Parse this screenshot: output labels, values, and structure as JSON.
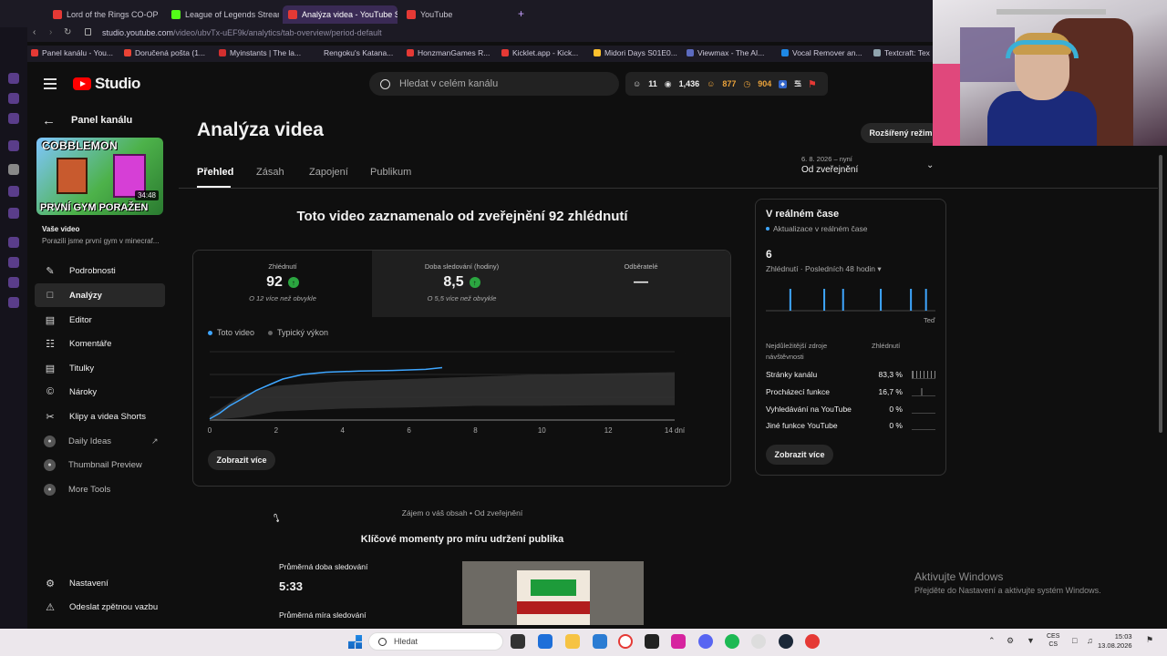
{
  "browser": {
    "tabs": [
      {
        "label": "Lord of the Rings CO-OP in",
        "color": "#e53935"
      },
      {
        "label": "League of Legends Stream",
        "color": "#53fc18"
      },
      {
        "label": "Analýza videa - YouTube S",
        "color": "#e53935"
      },
      {
        "label": "YouTube",
        "color": "#e53935"
      }
    ],
    "new_tab": "+",
    "url_host": "studio.youtube.com",
    "url_path": "/video/ubvTx-uEF9k/analytics/tab-overview/period-default",
    "bookmarks": [
      {
        "label": "Panel kanálu - You...",
        "color": "#e53935"
      },
      {
        "label": "Doručená pošta (1...",
        "color": "#ea4335"
      },
      {
        "label": "Myinstants | The la...",
        "color": "#d32f2f"
      },
      {
        "label": "Rengoku's Katana...",
        "color": "#7e57c2"
      },
      {
        "label": "HonzmanGames R...",
        "color": "#e53935"
      },
      {
        "label": "Kicklet.app - Kick...",
        "color": "#e53935"
      },
      {
        "label": "Midori Days S01E0...",
        "color": "#fbc02d"
      },
      {
        "label": "Viewmax - The AI...",
        "color": "#5c6bc0"
      },
      {
        "label": "Vocal Remover an...",
        "color": "#1e88e5"
      },
      {
        "label": "Textcraft: Tex",
        "color": "#90a4ae"
      }
    ]
  },
  "header": {
    "logo_text": "Studio",
    "search_placeholder": "Hledat v celém kanálu",
    "stats": {
      "subs": "11",
      "views": "1,436",
      "members": "877",
      "time": "904"
    }
  },
  "sidebar": {
    "panel_title": "Panel kanálu",
    "thumb_title_top": "COBBLEMON",
    "thumb_title_bottom": "PRVNÍ GYM PORAŽEN",
    "thumb_duration": "34:48",
    "your_video": "Vaše video",
    "video_title": "Porazili jsme první gym v minecraf...",
    "items": [
      {
        "label": "Podrobnosti",
        "icon": "pencil-icon"
      },
      {
        "label": "Analýzy",
        "icon": "analytics-icon"
      },
      {
        "label": "Editor",
        "icon": "film-icon"
      },
      {
        "label": "Komentáře",
        "icon": "comment-icon"
      },
      {
        "label": "Titulky",
        "icon": "subtitles-icon"
      },
      {
        "label": "Nároky",
        "icon": "copyright-icon"
      },
      {
        "label": "Klipy a videa Shorts",
        "icon": "scissors-icon"
      },
      {
        "label": "Daily Ideas",
        "icon": "extension-icon"
      },
      {
        "label": "Thumbnail Preview",
        "icon": "extension-icon"
      },
      {
        "label": "More Tools",
        "icon": "extension-icon"
      }
    ],
    "settings": "Nastavení",
    "feedback": "Odeslat zpětnou vazbu"
  },
  "main": {
    "title": "Analýza videa",
    "tabs": [
      "Přehled",
      "Zásah",
      "Zapojení",
      "Publikum"
    ],
    "extended_mode": "Rozšířený režim",
    "period_date": "6. 8. 2026 – nyní",
    "period_label": "Od zveřejnění",
    "headline": "Toto video zaznamenalo od zveřejnění 92 zhlédnutí",
    "metrics": [
      {
        "label": "Zhlédnutí",
        "value": "92",
        "sub": "O 12 více než obvykle",
        "up": true
      },
      {
        "label": "Doba sledování (hodiny)",
        "value": "8,5",
        "sub": "O 5,5 více než obvykle",
        "up": true
      },
      {
        "label": "Odběratelé",
        "value": "—",
        "sub": "",
        "up": false
      }
    ],
    "legend": {
      "this_video": "Toto video",
      "typical": "Typický výkon"
    },
    "show_more": "Zobrazit více",
    "interest": "Zájem o váš obsah • Od zveřejnění",
    "key_moments": "Klíčové momenty pro míru udržení publika",
    "avg_duration_label": "Průměrná doba sledování",
    "avg_duration_value": "5:33",
    "avg_rate_label": "Průměrná míra sledování"
  },
  "chart_data": {
    "type": "line",
    "x_ticks": [
      "0",
      "2",
      "4",
      "6",
      "8",
      "10",
      "12",
      "14 dní"
    ],
    "y_ticks": [
      "0",
      "40",
      "80",
      "120"
    ],
    "ylim": [
      0,
      120
    ],
    "xlim": [
      0,
      14
    ],
    "series": [
      {
        "name": "Toto video",
        "color": "#3ea6ff",
        "x": [
          0,
          0.3,
          0.6,
          1.0,
          1.4,
          1.8,
          2.2,
          2.8,
          3.5,
          4.5,
          5.5,
          6.5,
          7.0
        ],
        "y": [
          2,
          12,
          25,
          38,
          52,
          62,
          72,
          80,
          84,
          86,
          87,
          89,
          92
        ]
      },
      {
        "name": "Typický výkon",
        "color": "#333333",
        "x": [
          0,
          1,
          2,
          4,
          6,
          8,
          10,
          12,
          14
        ],
        "lower": [
          0,
          5,
          15,
          20,
          22,
          25,
          25,
          26,
          26
        ],
        "upper": [
          8,
          45,
          60,
          68,
          72,
          76,
          80,
          82,
          84
        ]
      }
    ]
  },
  "realtime": {
    "title": "V reálném čase",
    "update": "Aktualizace v reálném čase",
    "count": "6",
    "sub": "Zhlédnutí · Posledních 48 hodin",
    "now": "Teď",
    "bars": [
      0,
      0,
      0,
      0,
      0,
      0,
      1,
      0,
      0,
      0,
      0,
      0,
      0,
      0,
      0,
      1,
      0,
      0,
      0,
      0,
      1,
      0,
      0,
      0,
      0,
      0,
      0,
      0,
      0,
      0,
      1,
      0,
      0,
      0,
      0,
      0,
      0,
      0,
      1,
      0,
      0,
      0,
      1,
      0,
      0
    ],
    "sources_header": "Nejdůležitější zdroje návštěvnosti",
    "views_header": "Zhlédnutí",
    "sources": [
      {
        "label": "Stránky kanálu",
        "value": "83,3 %"
      },
      {
        "label": "Procházecí funkce",
        "value": "16,7 %"
      },
      {
        "label": "Vyhledávání na YouTube",
        "value": "0 %"
      },
      {
        "label": "Jiné funkce YouTube",
        "value": "0 %"
      }
    ],
    "show_more": "Zobrazit více"
  },
  "windows": {
    "activate_title": "Aktivujte Windows",
    "activate_sub": "Přejděte do Nastavení a aktivujte systém Windows.",
    "search": "Hledat",
    "lang_top": "CES",
    "lang_bottom": "CS",
    "time": "15:03",
    "date": "13.08.2026"
  }
}
